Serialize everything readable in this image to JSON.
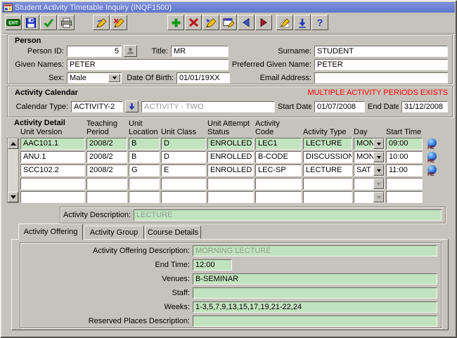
{
  "window": {
    "title": "Student Activity Timetable Inquiry (INQF1500)"
  },
  "toolbar": {
    "exit_glyph": "EXIT",
    "help_glyph": "?",
    "buttons": [
      "exit",
      "save",
      "accept",
      "print",
      "clear-form",
      "clear-block",
      "insert-record",
      "delete-record",
      "clear-record",
      "duplicate-record",
      "previous-record",
      "next-record",
      "edit",
      "list-of-values",
      "help"
    ]
  },
  "person": {
    "section_label": "Person",
    "person_id_label": "Person ID:",
    "person_id": "5",
    "title_label": "Title:",
    "title": "MR",
    "surname_label": "Surname:",
    "surname": "STUDENT",
    "given_names_label": "Given Names:",
    "given_names": "PETER",
    "preferred_given_name_label": "Preferred Given Name:",
    "preferred_given_name": "PETER",
    "sex_label": "Sex:",
    "sex": "Male",
    "date_of_birth_label": "Date Of Birth:",
    "date_of_birth": "01/01/19XX",
    "email_address_label": "Email Address:",
    "email_address": ""
  },
  "activity_calendar": {
    "section_label": "Activity Calendar",
    "warning": "MULTIPLE ACTIVITY PERIODS EXISTS",
    "calendar_type_label": "Calendar Type:",
    "calendar_type": "ACTIVITY-2",
    "calendar_type_description": "ACTIVITY - TWO",
    "start_date_label": "Start Date:",
    "start_date": "01/07/2008",
    "end_date_label": "End Date:",
    "end_date": "31/12/2008"
  },
  "activity_detail": {
    "section_label": "Activity Detail",
    "he_badge": "HE",
    "columns": [
      {
        "l1": "",
        "l2": "Unit Version"
      },
      {
        "l1": "Teaching",
        "l2": "Period"
      },
      {
        "l1": "Unit",
        "l2": "Location"
      },
      {
        "l1": "",
        "l2": "Unit Class"
      },
      {
        "l1": "Unit Attempt",
        "l2": "Status"
      },
      {
        "l1": "Activity",
        "l2": "Code"
      },
      {
        "l1": "",
        "l2": "Activity Type"
      },
      {
        "l1": "",
        "l2": "Day"
      },
      {
        "l1": "",
        "l2": "Start Time"
      }
    ],
    "rows": [
      {
        "unit_version": "AAC101.1",
        "teaching_period": "2008/2",
        "unit_location": "B",
        "unit_class": "D",
        "unit_attempt_status": "ENROLLED",
        "activity_code": "LEC1",
        "activity_type": "LECTURE",
        "day": "MON",
        "start_time": "09:00"
      },
      {
        "unit_version": "ANU.1",
        "teaching_period": "2008/2",
        "unit_location": "B",
        "unit_class": "D",
        "unit_attempt_status": "ENROLLED",
        "activity_code": "B-CODE",
        "activity_type": "DISCUSSION",
        "day": "MON",
        "start_time": "10:00"
      },
      {
        "unit_version": "SCC102.2",
        "teaching_period": "2008/2",
        "unit_location": "G",
        "unit_class": "E",
        "unit_attempt_status": "ENROLLED",
        "activity_code": "LEC-SP",
        "activity_type": "LECTURE",
        "day": "SAT",
        "start_time": "11:00"
      },
      {
        "unit_version": "",
        "teaching_period": "",
        "unit_location": "",
        "unit_class": "",
        "unit_attempt_status": "",
        "activity_code": "",
        "activity_type": "",
        "day": "",
        "start_time": ""
      },
      {
        "unit_version": "",
        "teaching_period": "",
        "unit_location": "",
        "unit_class": "",
        "unit_attempt_status": "",
        "activity_code": "",
        "activity_type": "",
        "day": "",
        "start_time": ""
      }
    ],
    "activity_description_label": "Activity Description:",
    "activity_description": "LECTURE"
  },
  "tabs": {
    "offering": "Activity Offering",
    "group": "Activity Group",
    "course": "Course Details"
  },
  "offering_tab": {
    "description_label": "Activity Offering Description:",
    "description": "MORNING LECTURE",
    "end_time_label": "End Time:",
    "end_time": "12:00",
    "venues_label": "Venues:",
    "venues": "B-SEMINAR",
    "staff_label": "Staff:",
    "staff": "",
    "weeks_label": "Weeks:",
    "weeks": "1-3,5,7,9,13,15,17,19,21-22,24",
    "reserved_places_label": "Reserved Places Description:",
    "reserved_places": ""
  },
  "colors": {
    "titlebar_blue": "#6a80d4",
    "field_green": "#c1e3bf",
    "warning_red": "#ff0000",
    "chrome_gray": "#c6c3bc"
  }
}
